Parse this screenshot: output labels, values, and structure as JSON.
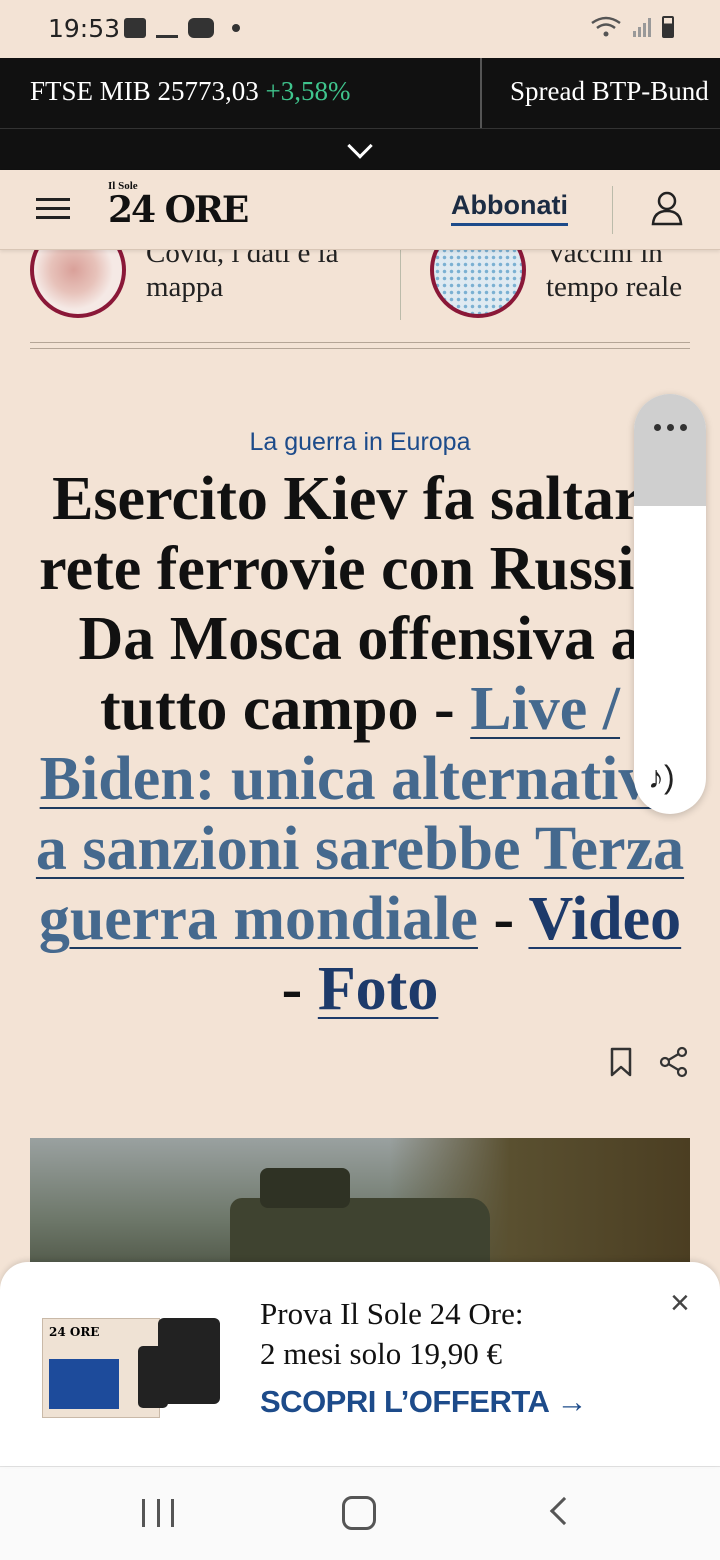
{
  "status_bar": {
    "time": "19:53",
    "icons": [
      "image-icon",
      "weather-icon",
      "youtube-icon",
      "dot-icon",
      "wifi-icon",
      "signal-icon",
      "battery-icon"
    ]
  },
  "ticker": {
    "items": [
      {
        "label": "FTSE MIB",
        "value": "25773,03",
        "change": "+3,58%"
      },
      {
        "label": "Spread BTP-Bund"
      }
    ]
  },
  "header": {
    "logo_small": "Il Sole",
    "logo_big": "24 ORE",
    "subscribe_label": "Abbonati"
  },
  "specials": [
    {
      "text_line1": "Covid, i dati e la",
      "text_line2": "mappa"
    },
    {
      "text_line1": "Vaccini in",
      "text_line2": "tempo reale"
    }
  ],
  "article": {
    "kicker": "La guerra in Europa",
    "headline": "Esercito Kiev fa saltare rete ferrovie con Russia. Da Mosca offensiva a tutto campo",
    "sep1": " - ",
    "link_live": "Live / Biden: unica alternativa a sanzioni sarebbe Terza guerra mondiale",
    "sep2": " - ",
    "link_video": "Video",
    "sep3": " - ",
    "link_foto": "Foto"
  },
  "promo": {
    "title_line1": "Prova Il Sole 24 Ore:",
    "title_line2": "2 mesi solo 19,90 €",
    "cta": "SCOPRI L’OFFERTA →",
    "close": "×",
    "paper_logo": "24 ORE"
  },
  "colors": {
    "background": "#f3e3d5",
    "accent_blue": "#1d4b8a",
    "ticker_positive": "#3fc48d",
    "special_ring": "#8a1838"
  }
}
